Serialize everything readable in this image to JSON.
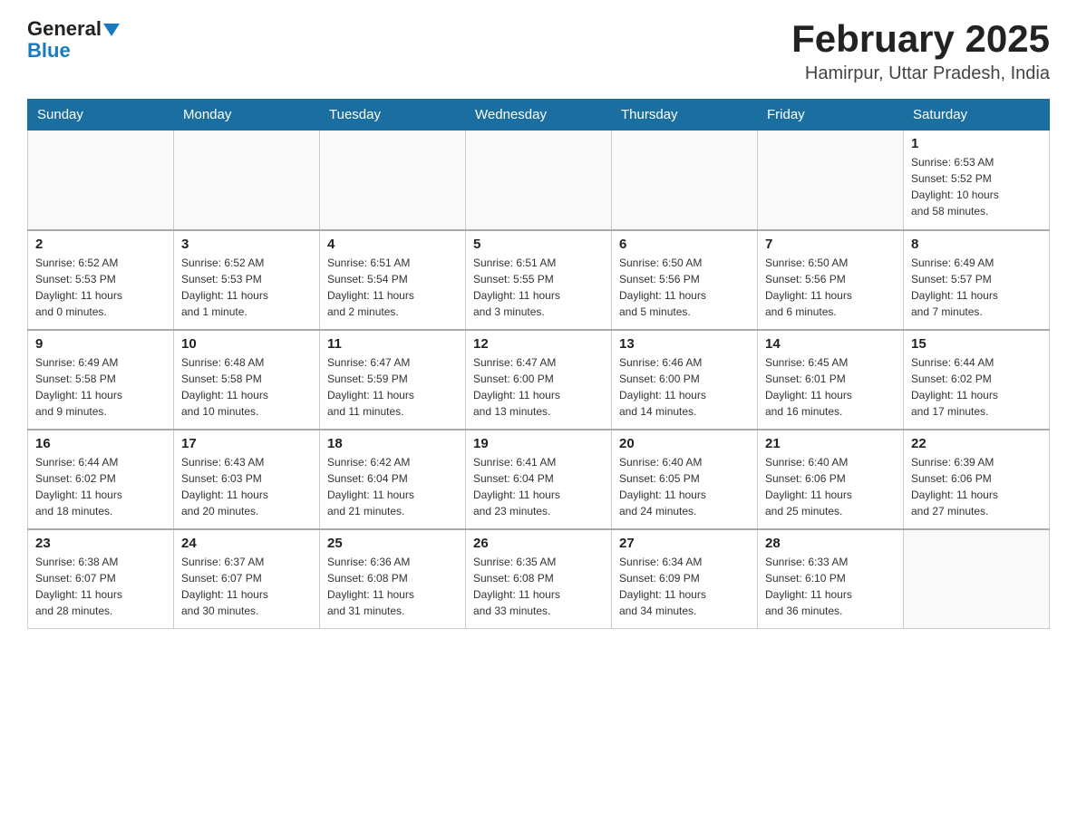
{
  "logo": {
    "general": "General",
    "blue": "Blue"
  },
  "title": "February 2025",
  "location": "Hamirpur, Uttar Pradesh, India",
  "weekdays": [
    "Sunday",
    "Monday",
    "Tuesday",
    "Wednesday",
    "Thursday",
    "Friday",
    "Saturday"
  ],
  "weeks": [
    [
      {
        "day": "",
        "info": ""
      },
      {
        "day": "",
        "info": ""
      },
      {
        "day": "",
        "info": ""
      },
      {
        "day": "",
        "info": ""
      },
      {
        "day": "",
        "info": ""
      },
      {
        "day": "",
        "info": ""
      },
      {
        "day": "1",
        "info": "Sunrise: 6:53 AM\nSunset: 5:52 PM\nDaylight: 10 hours\nand 58 minutes."
      }
    ],
    [
      {
        "day": "2",
        "info": "Sunrise: 6:52 AM\nSunset: 5:53 PM\nDaylight: 11 hours\nand 0 minutes."
      },
      {
        "day": "3",
        "info": "Sunrise: 6:52 AM\nSunset: 5:53 PM\nDaylight: 11 hours\nand 1 minute."
      },
      {
        "day": "4",
        "info": "Sunrise: 6:51 AM\nSunset: 5:54 PM\nDaylight: 11 hours\nand 2 minutes."
      },
      {
        "day": "5",
        "info": "Sunrise: 6:51 AM\nSunset: 5:55 PM\nDaylight: 11 hours\nand 3 minutes."
      },
      {
        "day": "6",
        "info": "Sunrise: 6:50 AM\nSunset: 5:56 PM\nDaylight: 11 hours\nand 5 minutes."
      },
      {
        "day": "7",
        "info": "Sunrise: 6:50 AM\nSunset: 5:56 PM\nDaylight: 11 hours\nand 6 minutes."
      },
      {
        "day": "8",
        "info": "Sunrise: 6:49 AM\nSunset: 5:57 PM\nDaylight: 11 hours\nand 7 minutes."
      }
    ],
    [
      {
        "day": "9",
        "info": "Sunrise: 6:49 AM\nSunset: 5:58 PM\nDaylight: 11 hours\nand 9 minutes."
      },
      {
        "day": "10",
        "info": "Sunrise: 6:48 AM\nSunset: 5:58 PM\nDaylight: 11 hours\nand 10 minutes."
      },
      {
        "day": "11",
        "info": "Sunrise: 6:47 AM\nSunset: 5:59 PM\nDaylight: 11 hours\nand 11 minutes."
      },
      {
        "day": "12",
        "info": "Sunrise: 6:47 AM\nSunset: 6:00 PM\nDaylight: 11 hours\nand 13 minutes."
      },
      {
        "day": "13",
        "info": "Sunrise: 6:46 AM\nSunset: 6:00 PM\nDaylight: 11 hours\nand 14 minutes."
      },
      {
        "day": "14",
        "info": "Sunrise: 6:45 AM\nSunset: 6:01 PM\nDaylight: 11 hours\nand 16 minutes."
      },
      {
        "day": "15",
        "info": "Sunrise: 6:44 AM\nSunset: 6:02 PM\nDaylight: 11 hours\nand 17 minutes."
      }
    ],
    [
      {
        "day": "16",
        "info": "Sunrise: 6:44 AM\nSunset: 6:02 PM\nDaylight: 11 hours\nand 18 minutes."
      },
      {
        "day": "17",
        "info": "Sunrise: 6:43 AM\nSunset: 6:03 PM\nDaylight: 11 hours\nand 20 minutes."
      },
      {
        "day": "18",
        "info": "Sunrise: 6:42 AM\nSunset: 6:04 PM\nDaylight: 11 hours\nand 21 minutes."
      },
      {
        "day": "19",
        "info": "Sunrise: 6:41 AM\nSunset: 6:04 PM\nDaylight: 11 hours\nand 23 minutes."
      },
      {
        "day": "20",
        "info": "Sunrise: 6:40 AM\nSunset: 6:05 PM\nDaylight: 11 hours\nand 24 minutes."
      },
      {
        "day": "21",
        "info": "Sunrise: 6:40 AM\nSunset: 6:06 PM\nDaylight: 11 hours\nand 25 minutes."
      },
      {
        "day": "22",
        "info": "Sunrise: 6:39 AM\nSunset: 6:06 PM\nDaylight: 11 hours\nand 27 minutes."
      }
    ],
    [
      {
        "day": "23",
        "info": "Sunrise: 6:38 AM\nSunset: 6:07 PM\nDaylight: 11 hours\nand 28 minutes."
      },
      {
        "day": "24",
        "info": "Sunrise: 6:37 AM\nSunset: 6:07 PM\nDaylight: 11 hours\nand 30 minutes."
      },
      {
        "day": "25",
        "info": "Sunrise: 6:36 AM\nSunset: 6:08 PM\nDaylight: 11 hours\nand 31 minutes."
      },
      {
        "day": "26",
        "info": "Sunrise: 6:35 AM\nSunset: 6:08 PM\nDaylight: 11 hours\nand 33 minutes."
      },
      {
        "day": "27",
        "info": "Sunrise: 6:34 AM\nSunset: 6:09 PM\nDaylight: 11 hours\nand 34 minutes."
      },
      {
        "day": "28",
        "info": "Sunrise: 6:33 AM\nSunset: 6:10 PM\nDaylight: 11 hours\nand 36 minutes."
      },
      {
        "day": "",
        "info": ""
      }
    ]
  ]
}
